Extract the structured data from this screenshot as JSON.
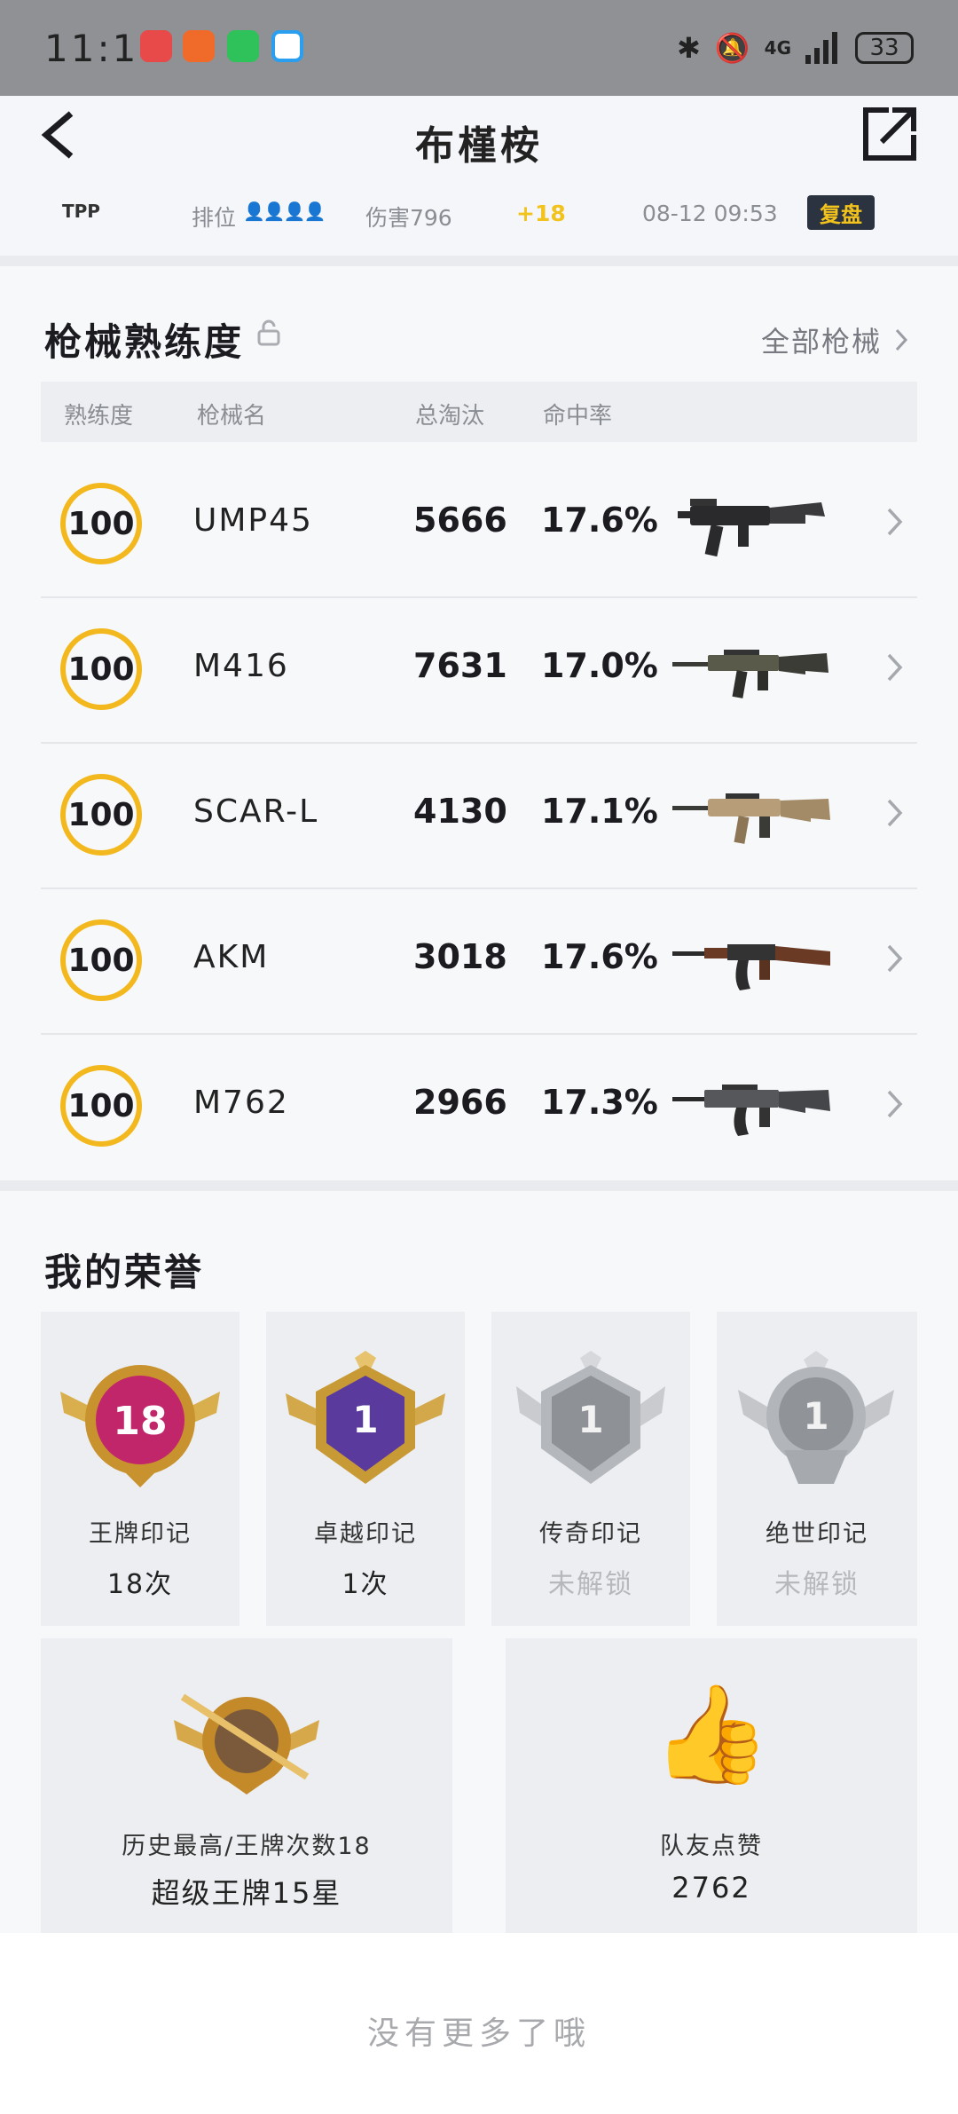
{
  "status_bar": {
    "time": "11:18",
    "network": "4G",
    "battery": "33",
    "app_icon_colors": [
      "#e84a4a",
      "#f06a2a",
      "#2fc25b",
      "#2a9ff0"
    ]
  },
  "header": {
    "title": "布槿桉",
    "match": {
      "mode": "TPP",
      "rank_label": "排位",
      "damage": "伤害796",
      "score_change": "+18",
      "time": "08-12 09:53",
      "replay_label": "复盘"
    }
  },
  "weapons": {
    "title": "枪械熟练度",
    "all_link": "全部枪械",
    "columns": {
      "proficiency": "熟练度",
      "name": "枪械名",
      "kills": "总淘汰",
      "accuracy": "命中率"
    },
    "rows": [
      {
        "level": "100",
        "name": "UMP45",
        "kills": "5666",
        "accuracy": "17.6%"
      },
      {
        "level": "100",
        "name": "M416",
        "kills": "7631",
        "accuracy": "17.0%"
      },
      {
        "level": "100",
        "name": "SCAR-L",
        "kills": "4130",
        "accuracy": "17.1%"
      },
      {
        "level": "100",
        "name": "AKM",
        "kills": "3018",
        "accuracy": "17.6%"
      },
      {
        "level": "100",
        "name": "M762",
        "kills": "2966",
        "accuracy": "17.3%"
      }
    ]
  },
  "honors": {
    "title": "我的荣誉",
    "badges": [
      {
        "label": "王牌印记",
        "value": "18次",
        "badge_text": "18",
        "locked": false
      },
      {
        "label": "卓越印记",
        "value": "1次",
        "badge_text": "1",
        "locked": false
      },
      {
        "label": "传奇印记",
        "value": "未解锁",
        "badge_text": "1",
        "locked": true
      },
      {
        "label": "绝世印记",
        "value": "未解锁",
        "badge_text": "1",
        "locked": true
      }
    ],
    "best_rank": {
      "label": "历史最高/王牌次数18",
      "value": "超级王牌15星"
    },
    "likes": {
      "label": "队友点赞",
      "value": "2762"
    }
  },
  "footer": {
    "no_more": "没有更多了哦"
  },
  "colors": {
    "accent_gold": "#f2b81d",
    "score_yellow": "#f2c21d"
  }
}
